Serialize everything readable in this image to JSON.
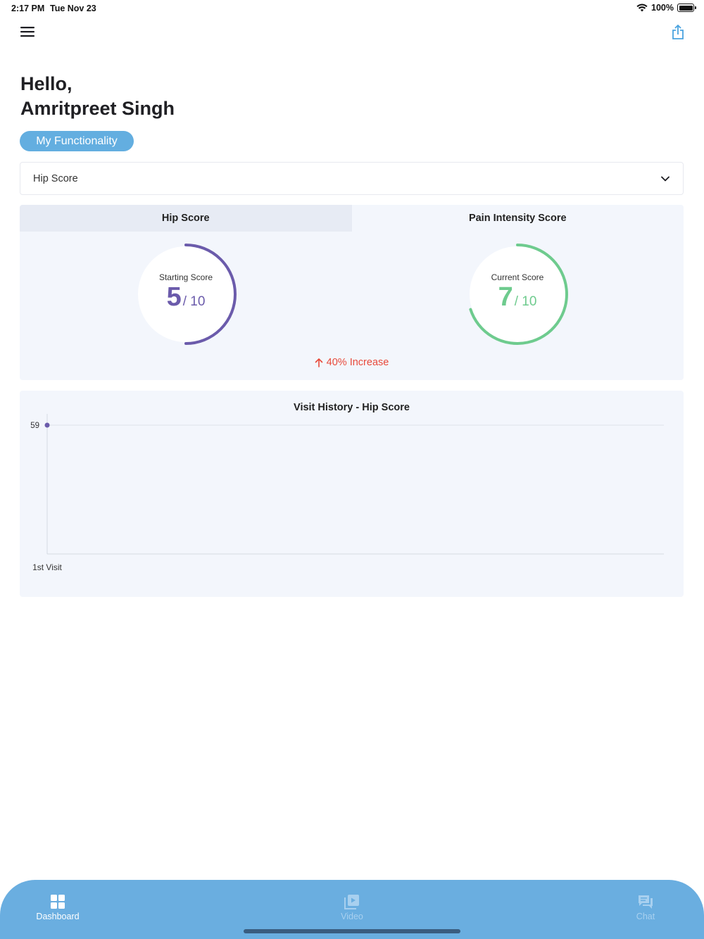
{
  "status_bar": {
    "time": "2:17 PM",
    "date": "Tue Nov 23",
    "battery": "100%"
  },
  "header": {
    "greeting_line1": "Hello,",
    "greeting_line2": "Amritpreet Singh",
    "pill_label": "My Functionality"
  },
  "selector": {
    "value": "Hip Score"
  },
  "scores": {
    "tabs": [
      "Hip Score",
      "Pain Intensity Score"
    ],
    "starting": {
      "label": "Starting Score",
      "value": "5",
      "max": "/ 10",
      "color": "#6b5bab"
    },
    "current": {
      "label": "Current Score",
      "value": "7",
      "max": "/ 10",
      "color": "#6ecb8e"
    },
    "change_text": "40% Increase",
    "change_color": "#e8493a"
  },
  "history": {
    "title": "Visit History  - Hip Score",
    "chart_data": {
      "type": "line",
      "title": "Visit History  - Hip Score",
      "categories": [
        "1st Visit"
      ],
      "series": [
        {
          "values": [
            59
          ]
        }
      ],
      "y_tick_labels": [
        "59"
      ],
      "grid": true
    }
  },
  "bottom_nav": {
    "items": [
      {
        "label": "Dashboard",
        "icon": "dashboard-icon",
        "active": true
      },
      {
        "label": "Video",
        "icon": "video-icon",
        "active": false
      },
      {
        "label": "Chat",
        "icon": "chat-icon",
        "active": false
      }
    ],
    "background": "#6aaee0"
  }
}
